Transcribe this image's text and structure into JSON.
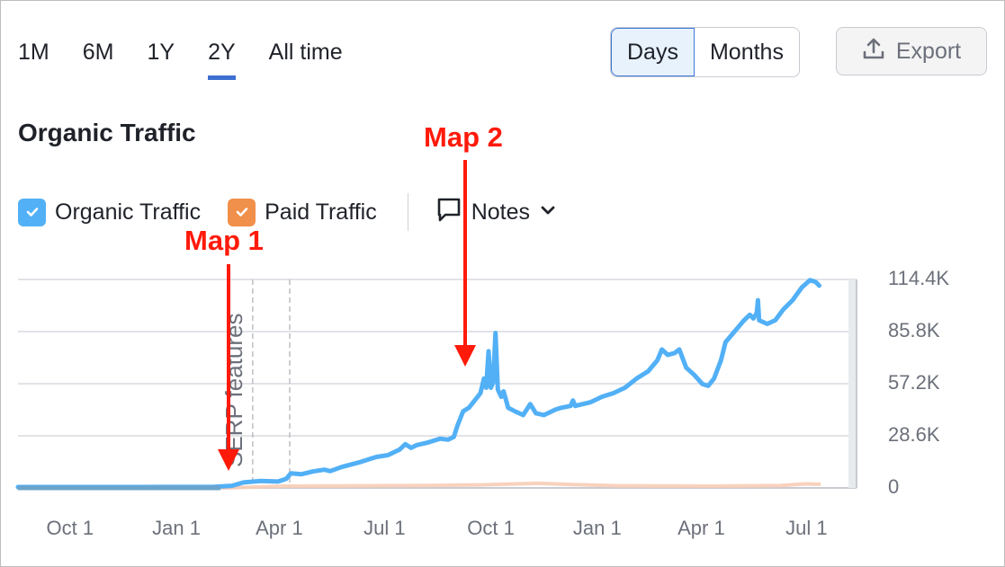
{
  "periods": [
    "1M",
    "6M",
    "1Y",
    "2Y",
    "All time"
  ],
  "active_period": "2Y",
  "granularity": {
    "options": [
      "Days",
      "Months"
    ],
    "active": "Days"
  },
  "export": {
    "label": "Export",
    "icon": "upload-icon"
  },
  "title": "Organic Traffic",
  "legend": {
    "organic": {
      "label": "Organic Traffic",
      "color": "#52b0f6",
      "checked": true
    },
    "paid": {
      "label": "Paid Traffic",
      "color": "#f0904a",
      "checked": true
    },
    "notes": {
      "label": "Notes",
      "icon": "comment-icon"
    }
  },
  "annotations": {
    "map1": "Map 1",
    "map2": "Map 2",
    "serp_label": "SERP features",
    "color": "#ff1a0a"
  },
  "chart_data": {
    "type": "line",
    "title": "Organic Traffic",
    "xlabel": "",
    "ylabel": "",
    "ylim": [
      0,
      114400
    ],
    "yticks": [
      "114.4K",
      "85.8K",
      "57.2K",
      "28.6K",
      "0"
    ],
    "ytick_values": [
      114400,
      85800,
      57200,
      28600,
      0
    ],
    "xticks": [
      "Oct 1",
      "Jan 1",
      "Apr 1",
      "Jul 1",
      "Oct 1",
      "Jan 1",
      "Apr 1",
      "Jul 1"
    ],
    "xtick_days": [
      45,
      137,
      226,
      317,
      409,
      501,
      591,
      682
    ],
    "x_range_days": [
      0,
      725
    ],
    "grid": true,
    "series": [
      {
        "name": "Organic Traffic",
        "color": "#52b0f6",
        "points": [
          [
            0,
            500
          ],
          [
            100,
            500
          ],
          [
            170,
            600
          ],
          [
            185,
            1200
          ],
          [
            195,
            3000
          ],
          [
            210,
            3800
          ],
          [
            225,
            3500
          ],
          [
            232,
            5000
          ],
          [
            236,
            8000
          ],
          [
            245,
            7500
          ],
          [
            255,
            9000
          ],
          [
            265,
            10000
          ],
          [
            270,
            9200
          ],
          [
            280,
            11500
          ],
          [
            295,
            14000
          ],
          [
            310,
            17000
          ],
          [
            320,
            18000
          ],
          [
            330,
            21000
          ],
          [
            335,
            24000
          ],
          [
            340,
            22000
          ],
          [
            345,
            23500
          ],
          [
            355,
            25000
          ],
          [
            365,
            27000
          ],
          [
            372,
            26500
          ],
          [
            377,
            28000
          ],
          [
            380,
            34000
          ],
          [
            385,
            42000
          ],
          [
            390,
            44000
          ],
          [
            395,
            48000
          ],
          [
            400,
            52000
          ],
          [
            403,
            60000
          ],
          [
            405,
            55000
          ],
          [
            407,
            75000
          ],
          [
            409,
            55000
          ],
          [
            411,
            58000
          ],
          [
            413,
            85000
          ],
          [
            415,
            54000
          ],
          [
            418,
            50000
          ],
          [
            420,
            53000
          ],
          [
            424,
            44000
          ],
          [
            430,
            42000
          ],
          [
            437,
            40000
          ],
          [
            443,
            46000
          ],
          [
            448,
            41000
          ],
          [
            455,
            40000
          ],
          [
            465,
            43000
          ],
          [
            470,
            44000
          ],
          [
            478,
            45000
          ],
          [
            480,
            48000
          ],
          [
            482,
            45000
          ],
          [
            495,
            47000
          ],
          [
            505,
            50000
          ],
          [
            515,
            52000
          ],
          [
            525,
            55000
          ],
          [
            535,
            60000
          ],
          [
            545,
            64000
          ],
          [
            553,
            70000
          ],
          [
            557,
            76000
          ],
          [
            562,
            73000
          ],
          [
            568,
            74000
          ],
          [
            572,
            76000
          ],
          [
            578,
            66000
          ],
          [
            585,
            62000
          ],
          [
            592,
            57000
          ],
          [
            597,
            56000
          ],
          [
            602,
            60000
          ],
          [
            608,
            70000
          ],
          [
            612,
            80000
          ],
          [
            620,
            86000
          ],
          [
            628,
            92000
          ],
          [
            633,
            95000
          ],
          [
            636,
            93000
          ],
          [
            639,
            96000
          ],
          [
            640,
            103000
          ],
          [
            641,
            92000
          ],
          [
            648,
            90000
          ],
          [
            655,
            92000
          ],
          [
            662,
            98000
          ],
          [
            670,
            103000
          ],
          [
            678,
            110000
          ],
          [
            685,
            114000
          ],
          [
            690,
            113000
          ],
          [
            693,
            111000
          ]
        ]
      },
      {
        "name": "Paid Traffic",
        "color": "#f0904a",
        "points": [
          [
            0,
            0
          ],
          [
            180,
            0
          ],
          [
            230,
            1000
          ],
          [
            300,
            1200
          ],
          [
            360,
            1400
          ],
          [
            400,
            1700
          ],
          [
            450,
            2500
          ],
          [
            480,
            1800
          ],
          [
            520,
            1200
          ],
          [
            600,
            1000
          ],
          [
            660,
            1300
          ],
          [
            680,
            2200
          ],
          [
            693,
            2000
          ]
        ]
      }
    ],
    "vertical_markers_days": [
      203,
      235
    ]
  }
}
